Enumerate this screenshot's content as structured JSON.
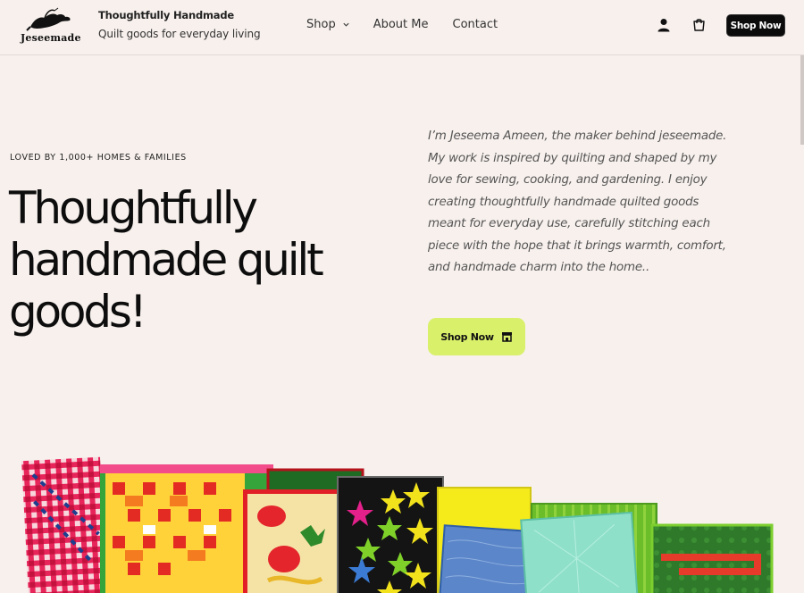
{
  "header": {
    "logo_text": "Jeseemade",
    "brand_title": "Thoughtfully Handmade",
    "brand_tagline": "Quilt goods for everyday living",
    "nav": [
      {
        "label": "Shop"
      },
      {
        "label": "About Me"
      },
      {
        "label": "Contact"
      }
    ],
    "cta_label": "Shop Now",
    "icons": [
      "account-icon",
      "cart-icon",
      "chevron-down-icon"
    ]
  },
  "hero": {
    "eyebrow": "LOVED BY 1,000+ HOMES & FAMILIES",
    "title_line1": "Thoughtfully",
    "title_line2": "handmade quilt",
    "title_line3": "goods!",
    "paragraph": "I’m Jeseema Ameen, the maker behind jeseemade. My work is inspired by quilting and shaped by my love for sewing, cooking, and gardening. I enjoy creating thoughtfully handmade quilted goods meant for everyday use, carefully stitching each piece with the hope that it brings warmth, comfort, and handmade charm into the home..",
    "cta_label": "Shop Now",
    "cta_icon": "storefront-icon"
  },
  "colors": {
    "background": "#f7f0ed",
    "accent_button": "#d9f06a",
    "header_button": "#0b0b0b"
  }
}
